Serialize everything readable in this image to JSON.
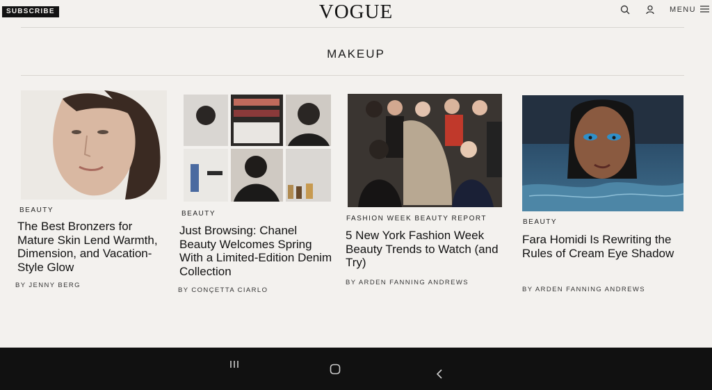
{
  "header": {
    "subscribe_label": "SUBSCRIBE",
    "logo": "VOGUE",
    "menu_label": "MENU",
    "icons": [
      "search-icon",
      "account-icon",
      "hamburger-menu-icon"
    ]
  },
  "section": {
    "title": "MAKEUP"
  },
  "articles": [
    {
      "kicker": "BEAUTY",
      "title": "The Best Bronzers for Mature Skin Lend Warmth, Dimension, and Vacation-Style Glow",
      "byline": "BY JENNY BERG"
    },
    {
      "kicker": "BEAUTY",
      "title": "Just Browsing: Chanel Beauty Welcomes Spring With a Limited-Edition Denim Collection",
      "byline": "BY CONÇETTA CIARLO"
    },
    {
      "kicker": "FASHION WEEK BEAUTY REPORT",
      "title": "5 New York Fashion Week Beauty Trends to Watch (and Try)",
      "byline": "BY ARDEN FANNING ANDREWS"
    },
    {
      "kicker": "BEAUTY",
      "title": "Fara Homidi Is Rewriting the Rules of Cream Eye Shadow",
      "byline": "BY ARDEN FANNING ANDREWS"
    }
  ],
  "navbar": {
    "icons": [
      "recent-apps-icon",
      "home-icon",
      "back-icon"
    ]
  },
  "colors": {
    "page_bg": "#f3f1ee",
    "text": "#111111",
    "nav_bg": "#111111"
  }
}
